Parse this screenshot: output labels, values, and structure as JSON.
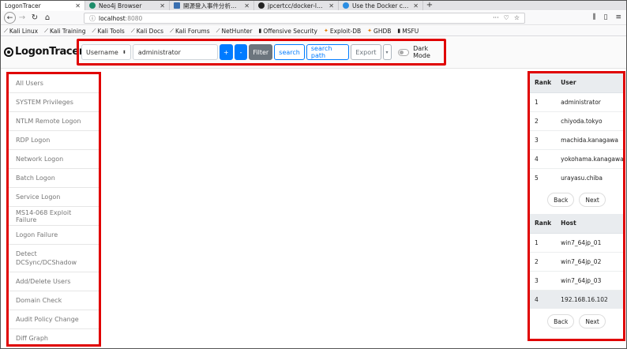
{
  "browser": {
    "tabs": [
      {
        "label": "LogonTracer",
        "active": true,
        "favicon_color": "#ffffff"
      },
      {
        "label": "Neo4j Browser",
        "active": false,
        "favicon_color": "#1d8d6b"
      },
      {
        "label": "開源登入事件分析工具",
        "active": false,
        "favicon_color": "#3a6fb0"
      },
      {
        "label": "jpcertcc/docker-logontra",
        "active": false,
        "favicon_color": "#222222"
      },
      {
        "label": "Use the Docker comman",
        "active": false,
        "favicon_color": "#2a8de2"
      }
    ],
    "new_tab": "+",
    "url_host": "localhost",
    "url_port": ":8080",
    "bookmarks": [
      {
        "label": "Kali Linux"
      },
      {
        "label": "Kali Training"
      },
      {
        "label": "Kali Tools"
      },
      {
        "label": "Kali Docs"
      },
      {
        "label": "Kali Forums"
      },
      {
        "label": "NetHunter"
      },
      {
        "label": "Offensive Security"
      },
      {
        "label": "Exploit-DB"
      },
      {
        "label": "GHDB"
      },
      {
        "label": "MSFU"
      }
    ]
  },
  "app": {
    "logo_text": "LogonTracer",
    "search": {
      "type_value": "Username",
      "input_value": "administrator",
      "plus_label": "+",
      "minus_label": "-",
      "filter_label": "Filter",
      "search_label": "search",
      "search_path_label": "search path",
      "export_label": "Export",
      "dark_mode_label": "Dark Mode"
    },
    "menu": [
      "All Users",
      "SYSTEM Privileges",
      "NTLM Remote Logon",
      "RDP Logon",
      "Network Logon",
      "Batch Logon",
      "Service Logon",
      "MS14-068 Exploit Failure",
      "Logon Failure",
      "Detect DCSync/DCShadow",
      "Add/Delete Users",
      "Domain Check",
      "Audit Policy Change",
      "Diff Graph"
    ],
    "user_rank": {
      "headers": [
        "Rank",
        "User"
      ],
      "rows": [
        [
          "1",
          "administrator"
        ],
        [
          "2",
          "chiyoda.tokyo"
        ],
        [
          "3",
          "machida.kanagawa"
        ],
        [
          "4",
          "yokohama.kanagawa"
        ],
        [
          "5",
          "urayasu.chiba"
        ]
      ],
      "back_label": "Back",
      "next_label": "Next"
    },
    "host_rank": {
      "headers": [
        "Rank",
        "Host"
      ],
      "rows": [
        [
          "1",
          "win7_64jp_01"
        ],
        [
          "2",
          "win7_64jp_02"
        ],
        [
          "3",
          "win7_64jp_03"
        ],
        [
          "4",
          "192.168.16.102"
        ]
      ],
      "back_label": "Back",
      "next_label": "Next"
    }
  },
  "colors": {
    "highlight_border": "#e00000",
    "primary": "#007bff",
    "secondary": "#6c757d"
  }
}
